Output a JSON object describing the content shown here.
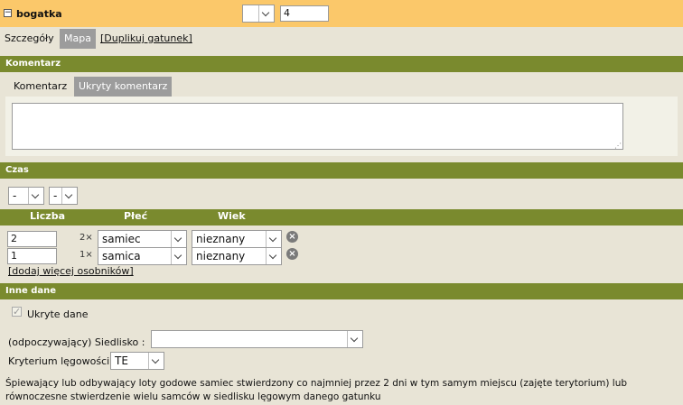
{
  "header": {
    "species_name": "bogatka",
    "expander_symbol": "−",
    "select_value": "",
    "number_value": "4"
  },
  "tabs": {
    "details": "Szczegóły",
    "map": "Mapa",
    "duplicate": "[Duplikuj gatunek]"
  },
  "comment_section": {
    "title": "Komentarz",
    "tab_comment": "Komentarz",
    "tab_hidden": "Ukryty komentarz",
    "text": ""
  },
  "time_section": {
    "title": "Czas",
    "select1": "-",
    "select2": "-"
  },
  "individuals": {
    "headers": {
      "count": "Liczba",
      "sex": "Płeć",
      "age": "Wiek"
    },
    "rows": [
      {
        "count": "2",
        "mult": "2×",
        "sex": "samiec",
        "age": "nieznany"
      },
      {
        "count": "1",
        "mult": "1×",
        "sex": "samica",
        "age": "nieznany"
      }
    ],
    "add_more": "[dodaj więcej osobników]",
    "remove_symbol": "×"
  },
  "other_section": {
    "title": "Inne dane",
    "hidden_data_label": "Ukryte dane",
    "hidden_data_checked": true,
    "habitat_label": "(odpoczywający) Siedlisko :",
    "habitat_value": "",
    "breeding_label": "Kryterium lęgowości",
    "breeding_value": "TE",
    "breeding_description": "Śpiewający lub odbywający loty godowe samiec stwierdzony co najmniej przez 2 dni w tym samym miejscu (zajęte terytorium) lub równoczesne stwierdzenie wielu samców w siedlisku lęgowym danego gatunku"
  },
  "colors": {
    "header_bg": "#fbc86a",
    "section_bar": "#7a8a2e",
    "page_bg": "#e8e4d6",
    "inactive_tab": "#9c9c9c"
  }
}
